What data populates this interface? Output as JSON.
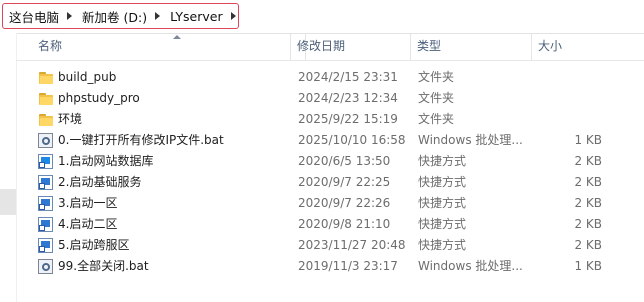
{
  "address_bar": {
    "crumbs": [
      "这台电脑",
      "新加卷 (D:)",
      "LYserver"
    ]
  },
  "columns": {
    "name": "名称",
    "date": "修改日期",
    "type": "类型",
    "size": "大小"
  },
  "files": [
    {
      "name": "build_pub",
      "date": "2024/2/15 23:31",
      "type": "文件夹",
      "size": "",
      "icon": "folder-icon"
    },
    {
      "name": "phpstudy_pro",
      "date": "2024/2/23 12:34",
      "type": "文件夹",
      "size": "",
      "icon": "folder-icon"
    },
    {
      "name": "环境",
      "date": "2025/9/22 15:19",
      "type": "文件夹",
      "size": "",
      "icon": "folder-icon"
    },
    {
      "name": "0.一键打开所有修改IP文件.bat",
      "date": "2025/10/10 16:58",
      "type": "Windows 批处理...",
      "size": "1 KB",
      "icon": "batch-file-icon"
    },
    {
      "name": "1.启动网站数据库",
      "date": "2020/6/5 13:50",
      "type": "快捷方式",
      "size": "2 KB",
      "icon": "shortcut-icon"
    },
    {
      "name": "2.启动基础服务",
      "date": "2020/9/7 22:25",
      "type": "快捷方式",
      "size": "2 KB",
      "icon": "shortcut-icon"
    },
    {
      "name": "3.启动一区",
      "date": "2020/9/7 22:26",
      "type": "快捷方式",
      "size": "2 KB",
      "icon": "shortcut-icon"
    },
    {
      "name": "4.启动二区",
      "date": "2020/9/8 21:10",
      "type": "快捷方式",
      "size": "2 KB",
      "icon": "shortcut-icon"
    },
    {
      "name": "5.启动跨服区",
      "date": "2023/11/27 20:48",
      "type": "快捷方式",
      "size": "2 KB",
      "icon": "shortcut-icon"
    },
    {
      "name": "99.全部关闭.bat",
      "date": "2019/11/3 23:17",
      "type": "Windows 批处理...",
      "size": "1 KB",
      "icon": "batch-file-icon"
    }
  ],
  "colors": {
    "highlight_border": "#e0465a",
    "header_text": "#4c607a",
    "folder": "#f3c24a"
  }
}
